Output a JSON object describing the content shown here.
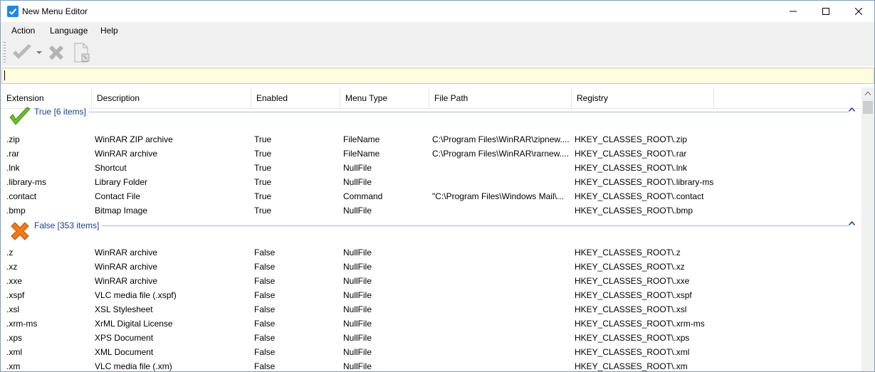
{
  "window": {
    "title": "New Menu Editor"
  },
  "menu": [
    "Action",
    "Language",
    "Help"
  ],
  "toolbar": {
    "icons": [
      "apply-check-icon",
      "dropdown-arrow-icon",
      "delete-x-icon",
      "copy-page-icon"
    ]
  },
  "filter": {
    "value": "",
    "placeholder": ""
  },
  "columns": [
    "Extension",
    "Description",
    "Enabled",
    "Menu Type",
    "File Path",
    "Registry"
  ],
  "groups": [
    {
      "label": "True [6 items]",
      "icon": "green-check-icon",
      "rows": [
        [
          ".zip",
          "WinRAR ZIP archive",
          "True",
          "FileName",
          "C:\\Program Files\\WinRAR\\zipnew....",
          "HKEY_CLASSES_ROOT\\.zip"
        ],
        [
          ".rar",
          "WinRAR archive",
          "True",
          "FileName",
          "C:\\Program Files\\WinRAR\\rarnew....",
          "HKEY_CLASSES_ROOT\\.rar"
        ],
        [
          ".lnk",
          "Shortcut",
          "True",
          "NullFile",
          "",
          "HKEY_CLASSES_ROOT\\.lnk"
        ],
        [
          ".library-ms",
          "Library Folder",
          "True",
          "NullFile",
          "",
          "HKEY_CLASSES_ROOT\\.library-ms"
        ],
        [
          ".contact",
          "Contact File",
          "True",
          "Command",
          "\"C:\\Program Files\\Windows Mail\\...",
          "HKEY_CLASSES_ROOT\\.contact"
        ],
        [
          ".bmp",
          "Bitmap Image",
          "True",
          "NullFile",
          "",
          "HKEY_CLASSES_ROOT\\.bmp"
        ]
      ]
    },
    {
      "label": "False [353 items]",
      "icon": "orange-x-icon",
      "rows": [
        [
          ".z",
          "WinRAR archive",
          "False",
          "NullFile",
          "",
          "HKEY_CLASSES_ROOT\\.z"
        ],
        [
          ".xz",
          "WinRAR archive",
          "False",
          "NullFile",
          "",
          "HKEY_CLASSES_ROOT\\.xz"
        ],
        [
          ".xxe",
          "WinRAR archive",
          "False",
          "NullFile",
          "",
          "HKEY_CLASSES_ROOT\\.xxe"
        ],
        [
          ".xspf",
          "VLC media file (.xspf)",
          "False",
          "NullFile",
          "",
          "HKEY_CLASSES_ROOT\\.xspf"
        ],
        [
          ".xsl",
          "XSL Stylesheet",
          "False",
          "NullFile",
          "",
          "HKEY_CLASSES_ROOT\\.xsl"
        ],
        [
          ".xrm-ms",
          "XrML Digital License",
          "False",
          "NullFile",
          "",
          "HKEY_CLASSES_ROOT\\.xrm-ms"
        ],
        [
          ".xps",
          "XPS Document",
          "False",
          "NullFile",
          "",
          "HKEY_CLASSES_ROOT\\.xps"
        ],
        [
          ".xml",
          "XML Document",
          "False",
          "NullFile",
          "",
          "HKEY_CLASSES_ROOT\\.xml"
        ],
        [
          ".xm",
          "VLC media file (.xm)",
          "False",
          "NullFile",
          "",
          "HKEY_CLASSES_ROOT\\.xm"
        ]
      ]
    }
  ]
}
